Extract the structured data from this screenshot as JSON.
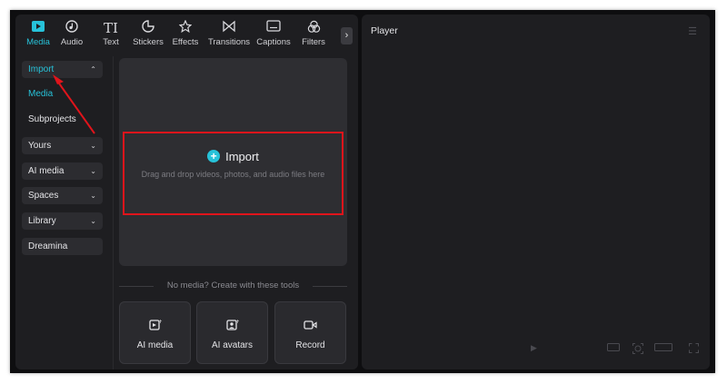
{
  "toolbar": {
    "tabs": [
      {
        "label": "Media",
        "icon": "media-icon"
      },
      {
        "label": "Audio",
        "icon": "audio-icon"
      },
      {
        "label": "Text",
        "icon": "text-icon"
      },
      {
        "label": "Stickers",
        "icon": "stickers-icon"
      },
      {
        "label": "Effects",
        "icon": "effects-icon"
      },
      {
        "label": "Transitions",
        "icon": "transitions-icon"
      },
      {
        "label": "Captions",
        "icon": "captions-icon"
      },
      {
        "label": "Filters",
        "icon": "filters-icon"
      }
    ],
    "active_tab": "Media",
    "more_glyph": "›"
  },
  "sidebar": {
    "import_label": "Import",
    "import_sub": [
      "Media",
      "Subprojects"
    ],
    "items": [
      "Yours",
      "AI media",
      "Spaces",
      "Library",
      "Dreamina"
    ]
  },
  "dropzone": {
    "title": "Import",
    "hint": "Drag and drop videos, photos, and audio files here"
  },
  "tools": {
    "heading": "No media? Create with these tools",
    "cards": [
      "AI media",
      "AI avatars",
      "Record"
    ]
  },
  "player": {
    "title": "Player"
  },
  "colors": {
    "accent": "#27c2d9",
    "highlight": "#e0141b",
    "panel": "#1e1e21"
  }
}
